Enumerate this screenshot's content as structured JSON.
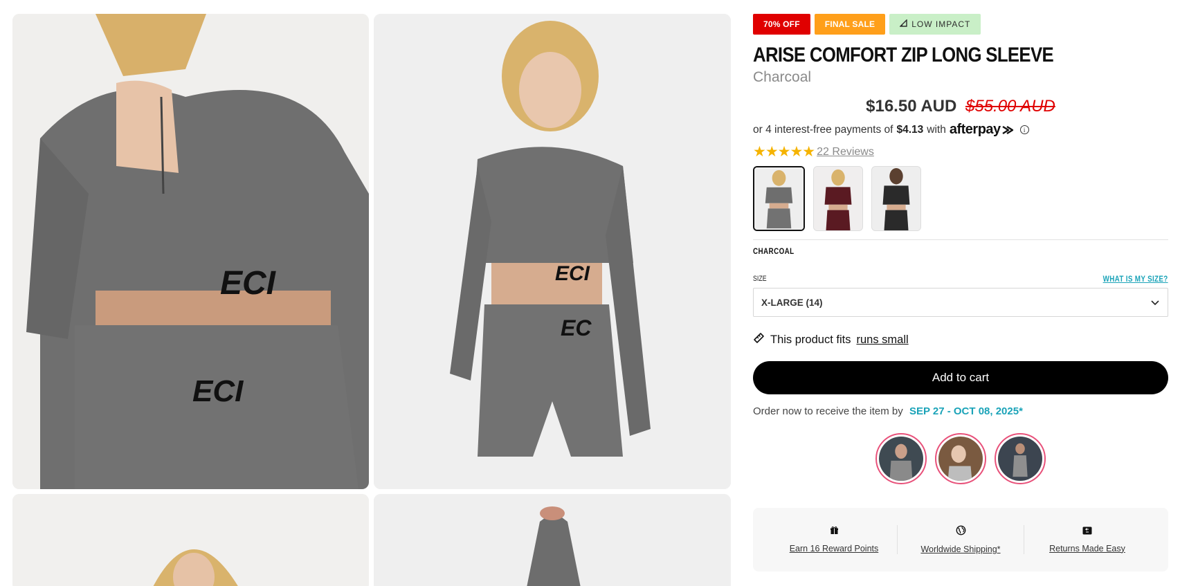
{
  "badges": {
    "discount": "70% OFF",
    "final_sale": "FINAL SALE",
    "impact": "LOW IMPACT"
  },
  "product": {
    "title": "ARISE COMFORT ZIP LONG SLEEVE",
    "color": "Charcoal",
    "price_now": "$16.50 AUD",
    "price_was": "$55.00 AUD"
  },
  "afterpay": {
    "prefix": "or 4 interest-free payments of",
    "amount": "$4.13",
    "suffix": "with",
    "brand": "afterpay"
  },
  "rating": {
    "stars": "★★★★★",
    "value_out_of_5": 4.5,
    "reviews": "22 Reviews"
  },
  "swatches": [
    {
      "name": "Charcoal",
      "selected": true,
      "color": "#6e6e6e"
    },
    {
      "name": "Burgundy",
      "selected": false,
      "color": "#5a1a22"
    },
    {
      "name": "Black",
      "selected": false,
      "color": "#2a2a2a"
    }
  ],
  "swatch_label": "CHARCOAL",
  "size": {
    "label": "SIZE",
    "help": "WHAT IS MY SIZE?",
    "selected": "X-LARGE (14)"
  },
  "fit": {
    "text": "This product fits",
    "link": "runs small"
  },
  "cart": {
    "label": "Add to cart"
  },
  "delivery": {
    "text": "Order now to receive the item by",
    "date": "SEP 27 - OCT 08, 2025*"
  },
  "perks": [
    {
      "icon": "gift-icon",
      "label": "Earn 16 Reward Points"
    },
    {
      "icon": "globe-icon",
      "label": "Worldwide Shipping*"
    },
    {
      "icon": "returns-icon",
      "label": "Returns Made Easy"
    }
  ],
  "colors": {
    "sale_red": "#e00000",
    "final_orange": "#ff9f1a",
    "impact_green": "#c9efc7",
    "accent_teal": "#1aa3b8",
    "star_gold": "#f5b301",
    "ugc_ring": "#e8517a"
  }
}
